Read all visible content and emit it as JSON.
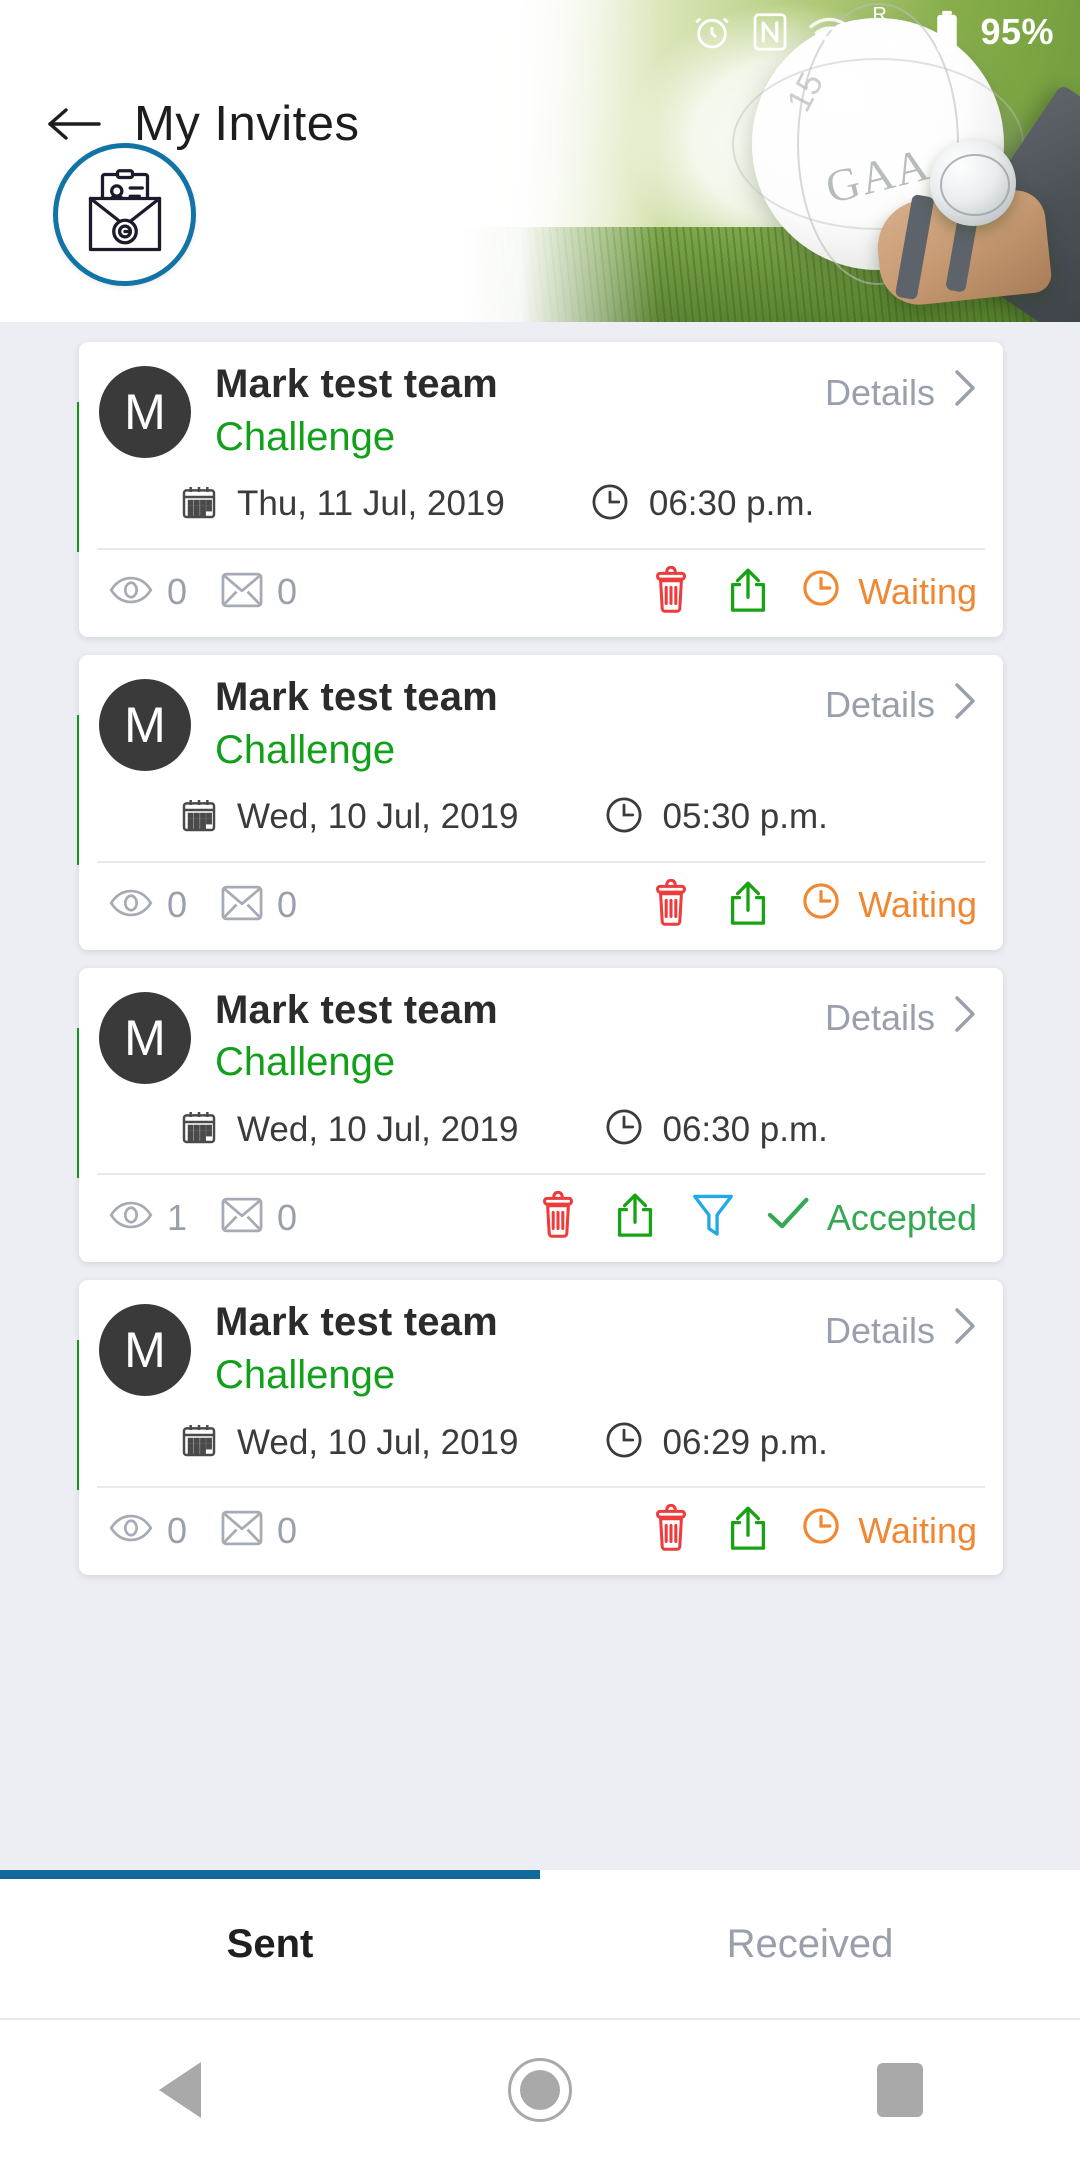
{
  "status_bar": {
    "battery_percent": "95%",
    "roaming_label": "R",
    "icons": [
      "alarm-icon",
      "nfc-icon",
      "wifi-icon",
      "cellular-signal-icon",
      "battery-icon"
    ]
  },
  "header": {
    "title": "My Invites",
    "back_icon": "back-arrow-icon",
    "badge_icon": "invite-envelope-icon",
    "badge_ring_color": "#1173a6"
  },
  "colors": {
    "accent_green": "#119b1b",
    "event_green": "#12a01b",
    "waiting_orange": "#f08733",
    "accepted_green": "#34a853",
    "delete_red": "#ee3b3b",
    "share_green": "#17a313",
    "filter_blue": "#21a8e8",
    "tab_indicator": "#11699c"
  },
  "cards": [
    {
      "avatar_initial": "M",
      "team_name": "Mark test team",
      "event_type": "Challenge",
      "details_label": "Details",
      "date": "Thu, 11 Jul, 2019",
      "time": "06:30 p.m.",
      "views_count": "0",
      "messages_count": "0",
      "has_filter": false,
      "status_label": "Waiting",
      "status_kind": "waiting"
    },
    {
      "avatar_initial": "M",
      "team_name": "Mark test team",
      "event_type": "Challenge",
      "details_label": "Details",
      "date": "Wed, 10 Jul, 2019",
      "time": "05:30 p.m.",
      "views_count": "0",
      "messages_count": "0",
      "has_filter": false,
      "status_label": "Waiting",
      "status_kind": "waiting"
    },
    {
      "avatar_initial": "M",
      "team_name": "Mark test team",
      "event_type": "Challenge",
      "details_label": "Details",
      "date": "Wed, 10 Jul, 2019",
      "time": "06:30 p.m.",
      "views_count": "1",
      "messages_count": "0",
      "has_filter": true,
      "status_label": "Accepted",
      "status_kind": "accepted"
    },
    {
      "avatar_initial": "M",
      "team_name": "Mark test team",
      "event_type": "Challenge",
      "details_label": "Details",
      "date": "Wed, 10 Jul, 2019",
      "time": "06:29 p.m.",
      "views_count": "0",
      "messages_count": "0",
      "has_filter": false,
      "status_label": "Waiting",
      "status_kind": "waiting"
    }
  ],
  "tabs": [
    {
      "label": "Sent",
      "active": true
    },
    {
      "label": "Received",
      "active": false
    }
  ],
  "nav_bar": {
    "back_icon": "nav-back-triangle-icon",
    "home_icon": "nav-home-circle-icon",
    "recents_icon": "nav-recents-square-icon"
  }
}
